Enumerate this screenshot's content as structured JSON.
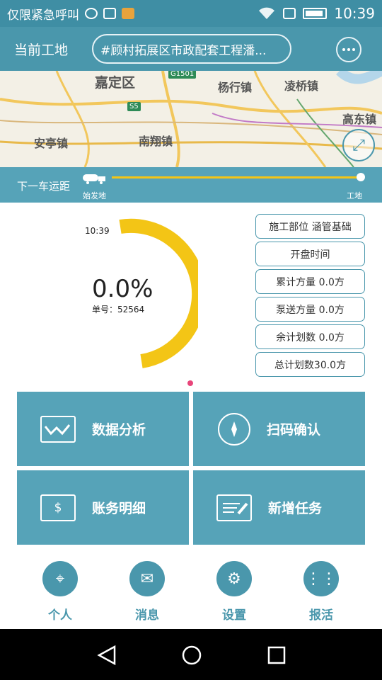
{
  "status_bar": {
    "label": "仅限紧急呼叫",
    "time": "10:39"
  },
  "header": {
    "site_label": "当前工地",
    "site_value": "#顾村拓展区市政配套工程潘...",
    "more_icon": "more-horizontal-icon"
  },
  "map": {
    "labels": [
      "嘉定区",
      "杨行镇",
      "凌桥镇",
      "高东镇",
      "安亭镇",
      "南翔镇"
    ],
    "badges": [
      "G1501",
      "S5"
    ]
  },
  "distance": {
    "label": "下一车运距",
    "start_label": "始发地",
    "end_label": "工地",
    "progress": 1.0
  },
  "gauge": {
    "time": "10:39",
    "percent": "0.0%",
    "order_label": "单号：52564"
  },
  "info": [
    "施工部位 涵管基础",
    "开盘时间",
    "累计方量 0.0方",
    "泵送方量 0.0方",
    "余计划数 0.0方",
    "总计划数30.0方"
  ],
  "tiles": {
    "data_analysis": "数据分析",
    "scan_confirm": "扫码确认",
    "account_detail": "账务明细",
    "new_task": "新增任务"
  },
  "nav": {
    "personal": "个人",
    "messages": "消息",
    "settings": "设置",
    "report": "报活"
  }
}
